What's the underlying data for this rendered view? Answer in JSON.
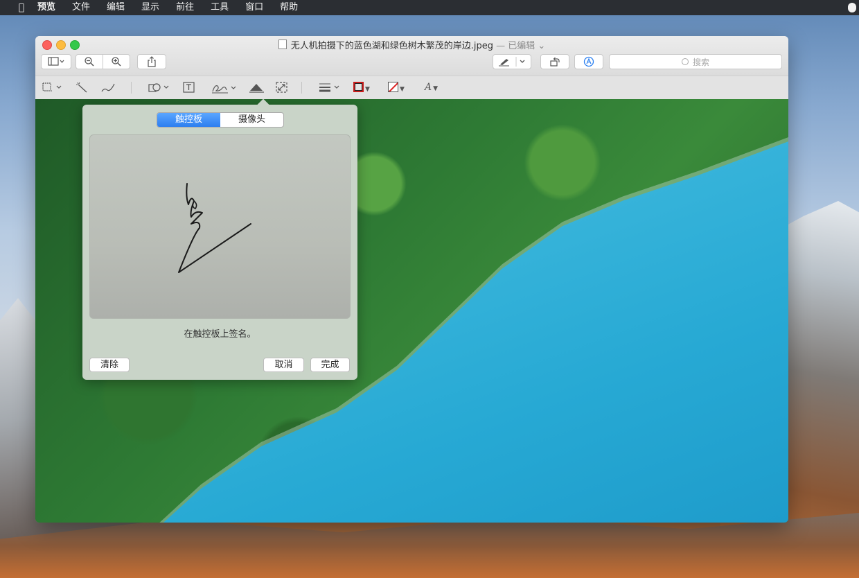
{
  "menubar": {
    "apple_icon": "apple-logo-icon",
    "items": [
      "预览",
      "文件",
      "编辑",
      "显示",
      "前往",
      "工具",
      "窗口",
      "帮助"
    ]
  },
  "window": {
    "filename": "无人机拍摄下的蓝色湖和绿色树木繁茂的岸边.jpeg",
    "status": "— 已编辑 ⌄",
    "search_placeholder": "搜索"
  },
  "toolbar": {
    "sidebar_icon": "sidebar-icon",
    "zoom_out_icon": "zoom-out-icon",
    "zoom_in_icon": "zoom-in-icon",
    "share_icon": "share-icon",
    "pen_icon": "markup-pen-icon",
    "rotate_icon": "rotate-icon",
    "markup_icon": "markup-toolbar-icon"
  },
  "markup": {
    "tools": [
      "selection-icon",
      "instant-alpha-icon",
      "sketch-icon",
      "shapes-icon",
      "text-icon",
      "signature-icon",
      "adjust-color-icon",
      "adjust-size-icon",
      "line-style-icon",
      "border-color-icon",
      "fill-color-icon",
      "text-style-icon"
    ],
    "border_color": "#c81c1c",
    "fill_color": "#ffffff"
  },
  "signature_popover": {
    "tabs": [
      "触控板",
      "摄像头"
    ],
    "active_tab": "触控板",
    "prompt": "在触控板上签名。",
    "clear_label": "清除",
    "cancel_label": "取消",
    "done_label": "完成"
  }
}
